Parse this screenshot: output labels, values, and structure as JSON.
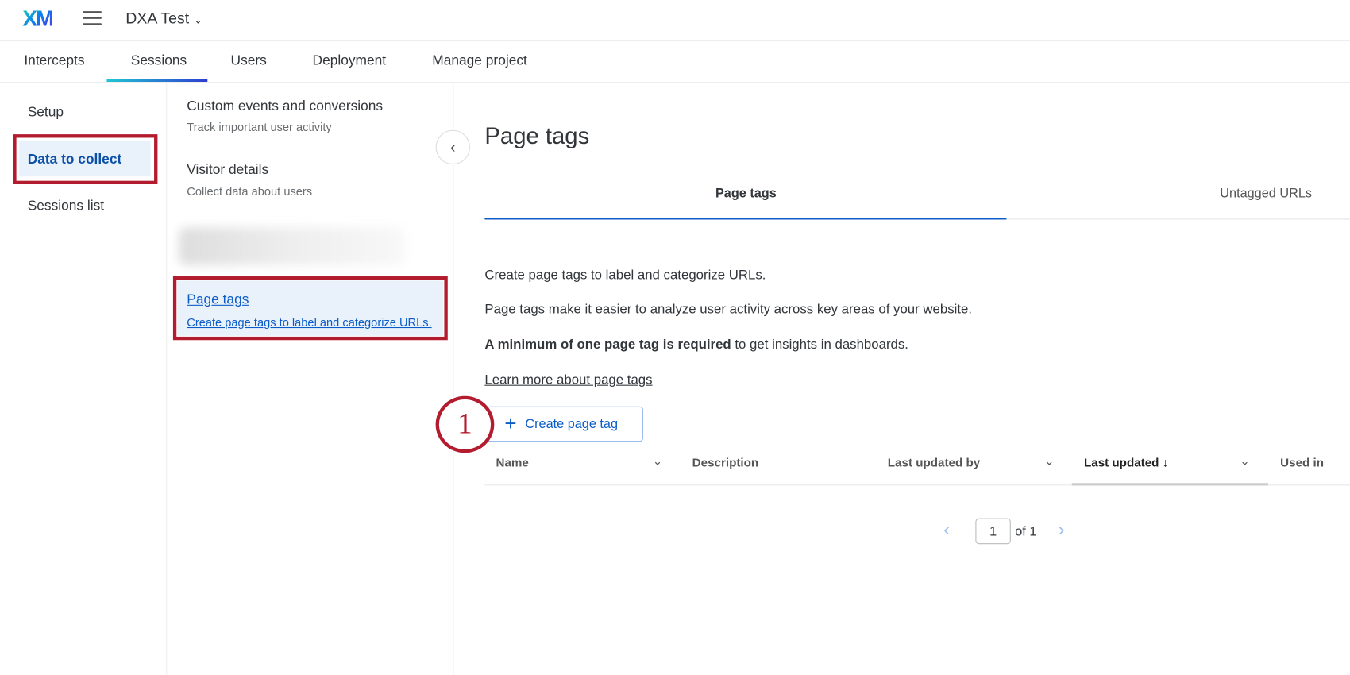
{
  "header": {
    "logo": "XM",
    "project": "DXA Test"
  },
  "nav": {
    "tabs": [
      "Intercepts",
      "Sessions",
      "Users",
      "Deployment",
      "Manage project"
    ],
    "active": "Sessions"
  },
  "sidebar": {
    "items": [
      "Setup",
      "Data to collect",
      "Sessions list"
    ],
    "active": "Data to collect"
  },
  "subnav": {
    "items": [
      {
        "title": "Custom events and conversions",
        "desc": "Track important user activity"
      },
      {
        "title": "Visitor details",
        "desc": "Collect data about users"
      },
      {
        "title": "Page tags",
        "desc": "Create page tags to label and categorize URLs."
      }
    ]
  },
  "main": {
    "title": "Page tags",
    "tabs": [
      "Page tags",
      "Untagged URLs"
    ],
    "para1": "Create page tags to label and categorize URLs.",
    "para2": "Page tags make it easier to analyze user activity across key areas of your website.",
    "para3_bold": "A minimum of one page tag is required",
    "para3_rest": " to get insights in dashboards.",
    "learn_more": "Learn more about page tags",
    "create_button": "Create page tag",
    "step_number": "1",
    "columns": [
      "Name",
      "Description",
      "Last updated by",
      "Last updated",
      "Used in"
    ],
    "pager": {
      "page": "1",
      "of": "of 1"
    }
  },
  "colors": {
    "accent": "#0b5cc9",
    "highlight": "#b31b2e"
  }
}
